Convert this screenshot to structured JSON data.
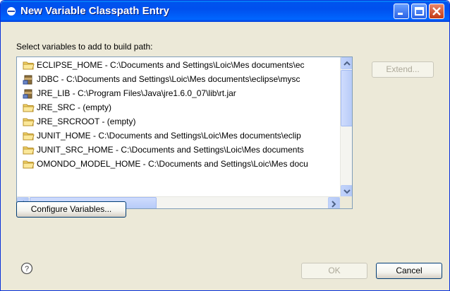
{
  "window": {
    "title": "New Variable Classpath Entry"
  },
  "instruction": "Select variables to add to build path:",
  "variables": [
    {
      "label": "ECLIPSE_HOME - C:\\Documents and Settings\\Loic\\Mes documents\\ec",
      "icon": "folder-icon"
    },
    {
      "label": "JDBC - C:\\Documents and Settings\\Loic\\Mes documents\\eclipse\\mysc",
      "icon": "jar-icon"
    },
    {
      "label": "JRE_LIB - C:\\Program Files\\Java\\jre1.6.0_07\\lib\\rt.jar",
      "icon": "jar-icon"
    },
    {
      "label": "JRE_SRC - (empty)",
      "icon": "folder-icon"
    },
    {
      "label": "JRE_SRCROOT - (empty)",
      "icon": "folder-icon"
    },
    {
      "label": "JUNIT_HOME - C:\\Documents and Settings\\Loic\\Mes documents\\eclip",
      "icon": "folder-icon"
    },
    {
      "label": "JUNIT_SRC_HOME - C:\\Documents and Settings\\Loic\\Mes documents",
      "icon": "folder-icon"
    },
    {
      "label": "OMONDO_MODEL_HOME - C:\\Documents and Settings\\Loic\\Mes docu",
      "icon": "folder-icon"
    }
  ],
  "buttons": {
    "extend": "Extend...",
    "configure": "Configure Variables...",
    "ok": "OK",
    "cancel": "Cancel"
  },
  "colors": {
    "titlebar": "#0053ee",
    "dialog_bg": "#ece9d8",
    "list_border": "#7f9db9"
  }
}
